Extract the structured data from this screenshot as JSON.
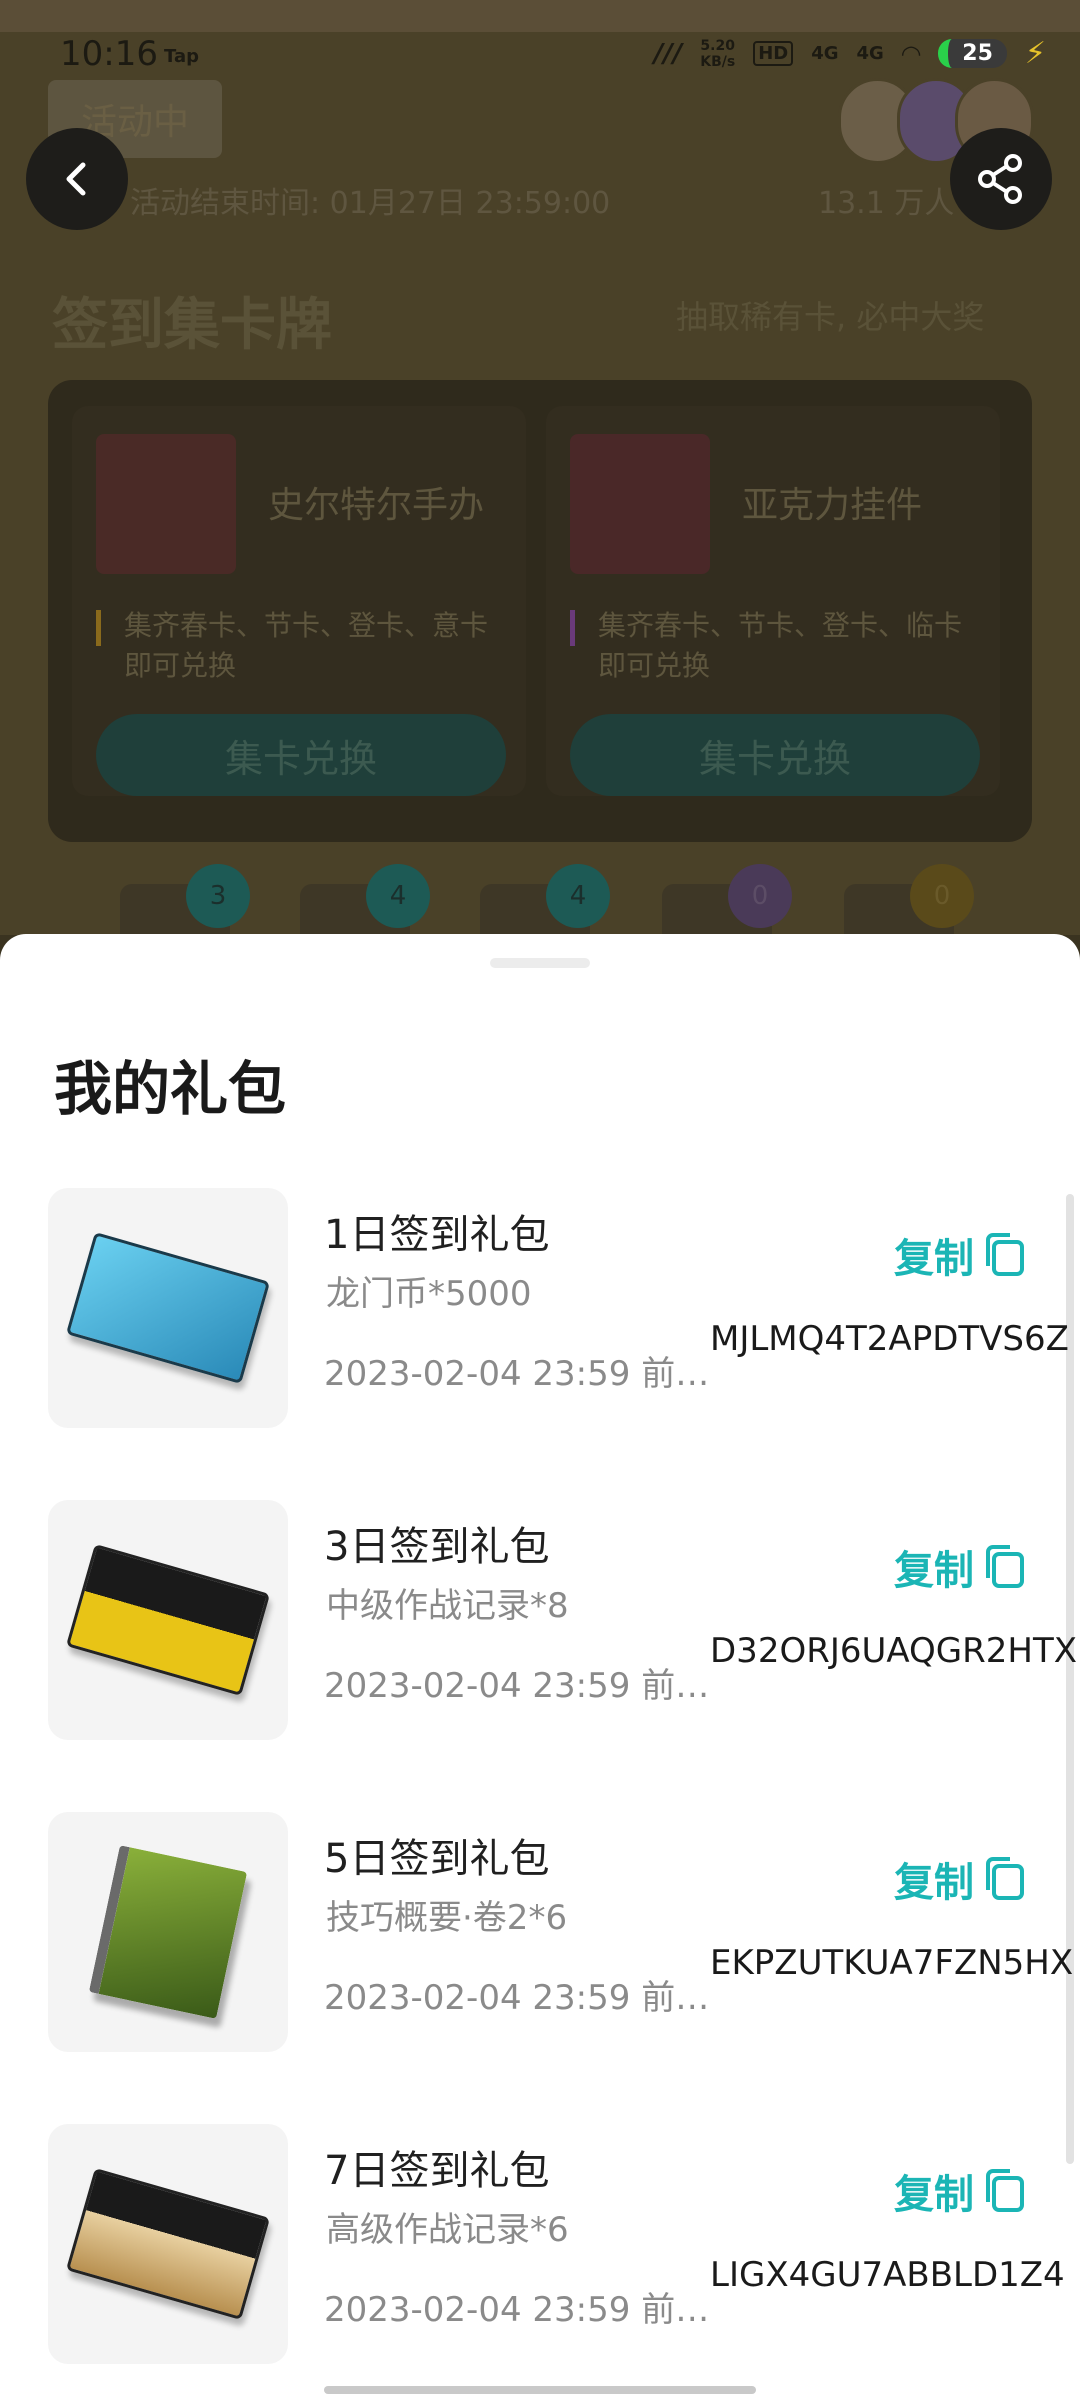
{
  "status_bar": {
    "time": "10:16",
    "tap_label": "Tap",
    "network_speed": "5.20",
    "network_unit": "KB/s",
    "hd_label": "HD",
    "net_4g_1": "4G",
    "net_4g_2": "4G",
    "battery": "25"
  },
  "background": {
    "tag": "活动中",
    "end_time": "活动结束时间: 01月27日 23:59:00",
    "participants": "13.1 万人",
    "title": "签到集卡牌",
    "subtitle": "抽取稀有卡, 必中大奖",
    "cards": [
      {
        "name": "史尔特尔手办",
        "desc": "集齐春卡、节卡、登卡、意卡即可兑换",
        "button": "集卡兑换"
      },
      {
        "name": "亚克力挂件",
        "desc": "集齐春卡、节卡、登卡、临卡即可兑换",
        "button": "集卡兑换"
      }
    ],
    "chips": [
      {
        "count": "3"
      },
      {
        "count": "4"
      },
      {
        "count": "4"
      },
      {
        "count": "0"
      },
      {
        "count": "0"
      }
    ]
  },
  "sheet": {
    "title": "我的礼包",
    "copy_label": "复制",
    "gifts": [
      {
        "name": "1日签到礼包",
        "item": "龙门币*5000",
        "date": "2023-02-04 23:59 前…",
        "code": "MJLMQ4T2APDTVS6Z"
      },
      {
        "name": "3日签到礼包",
        "item": "中级作战记录*8",
        "date": "2023-02-04 23:59 前…",
        "code": "D32ORJ6UAQGR2HTX"
      },
      {
        "name": "5日签到礼包",
        "item": "技巧概要·卷2*6",
        "date": "2023-02-04 23:59 前…",
        "code": "EKPZUTKUA7FZN5HX"
      },
      {
        "name": "7日签到礼包",
        "item": "高级作战记录*6",
        "date": "2023-02-04 23:59 前…",
        "code": "LIGX4GU7ABBLD1Z4"
      }
    ]
  },
  "colors": {
    "accent": "#1bb5b5",
    "sheet_bg": "#ffffff"
  },
  "icons": [
    "back-arrow-icon",
    "share-icon",
    "copy-icon"
  ]
}
